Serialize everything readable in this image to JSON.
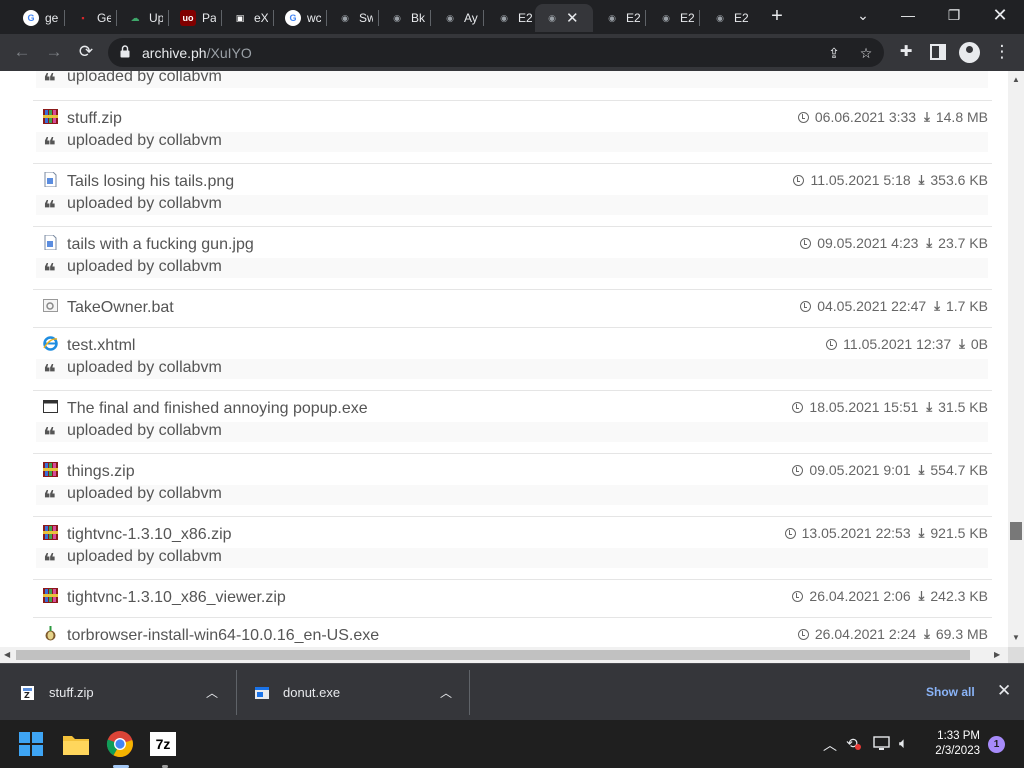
{
  "browser": {
    "tabs": [
      {
        "title": "ge",
        "icon": "google-icon",
        "color": "#ffffff",
        "glyph": "G"
      },
      {
        "title": "Ge",
        "icon": "red-app-icon",
        "color": "#d7262b",
        "glyph": "▪"
      },
      {
        "title": "Up",
        "icon": "green-cloud-icon",
        "color": "#3ea76a",
        "glyph": "☁"
      },
      {
        "title": "Pa",
        "icon": "ublock-icon",
        "color": "#800000",
        "glyph": "uo"
      },
      {
        "title": "eX",
        "icon": "frame-icon",
        "color": "#ffffff",
        "glyph": "▣"
      },
      {
        "title": "wc",
        "icon": "google-icon",
        "color": "#ffffff",
        "glyph": "G"
      },
      {
        "title": "Sw",
        "icon": "globe-icon",
        "color": "#9aa0a6",
        "glyph": "◉"
      },
      {
        "title": "Bk",
        "icon": "globe-icon",
        "color": "#9aa0a6",
        "glyph": "◉"
      },
      {
        "title": "Ay",
        "icon": "globe-icon",
        "color": "#9aa0a6",
        "glyph": "◉"
      },
      {
        "title": "E2",
        "icon": "globe-icon",
        "color": "#9aa0a6",
        "glyph": "◉"
      },
      {
        "title": "",
        "icon": "globe-icon",
        "color": "#9aa0a6",
        "glyph": "◉",
        "active": true
      },
      {
        "title": "E2",
        "icon": "globe-icon",
        "color": "#9aa0a6",
        "glyph": "◉"
      },
      {
        "title": "E2",
        "icon": "globe-icon",
        "color": "#9aa0a6",
        "glyph": "◉"
      },
      {
        "title": "E2",
        "icon": "globe-icon",
        "color": "#9aa0a6",
        "glyph": "◉"
      }
    ],
    "url_host": "archive.ph",
    "url_path": "/XuIYO"
  },
  "files": {
    "top_uploader": "uploaded by collabvm",
    "rows": [
      {
        "name": "stuff.zip",
        "type": "zip",
        "date": "06.06.2021 3:33",
        "size": "14.8 MB",
        "uploader": "uploaded by collabvm"
      },
      {
        "name": "Tails losing his tails.png",
        "type": "image",
        "date": "11.05.2021 5:18",
        "size": "353.6 KB",
        "uploader": "uploaded by collabvm"
      },
      {
        "name": "tails with a fucking gun.jpg",
        "type": "image",
        "date": "09.05.2021 4:23",
        "size": "23.7 KB",
        "uploader": "uploaded by collabvm"
      },
      {
        "name": "TakeOwner.bat",
        "type": "bat",
        "date": "04.05.2021 22:47",
        "size": "1.7 KB",
        "uploader": ""
      },
      {
        "name": "test.xhtml",
        "type": "ie",
        "date": "11.05.2021 12:37",
        "size": "0B",
        "uploader": "uploaded by collabvm"
      },
      {
        "name": "The final and finished annoying popup.exe",
        "type": "exe",
        "date": "18.05.2021 15:51",
        "size": "31.5 KB",
        "uploader": "uploaded by collabvm"
      },
      {
        "name": "things.zip",
        "type": "zip",
        "date": "09.05.2021 9:01",
        "size": "554.7 KB",
        "uploader": "uploaded by collabvm"
      },
      {
        "name": "tightvnc-1.3.10_x86.zip",
        "type": "zip",
        "date": "13.05.2021 22:53",
        "size": "921.5 KB",
        "uploader": "uploaded by collabvm"
      },
      {
        "name": "tightvnc-1.3.10_x86_viewer.zip",
        "type": "zip",
        "date": "26.04.2021 2:06",
        "size": "242.3 KB",
        "uploader": ""
      },
      {
        "name": "torbrowser-install-win64-10.0.16_en-US.exe",
        "type": "tor",
        "date": "26.04.2021 2:24",
        "size": "69.3 MB",
        "uploader": ""
      }
    ]
  },
  "downloads": {
    "items": [
      {
        "name": "stuff.zip"
      },
      {
        "name": "donut.exe"
      }
    ],
    "show_all": "Show all"
  },
  "taskbar": {
    "time": "1:33 PM",
    "date": "2/3/2023",
    "notifications": "1",
    "sevenzip_label": "7z"
  }
}
